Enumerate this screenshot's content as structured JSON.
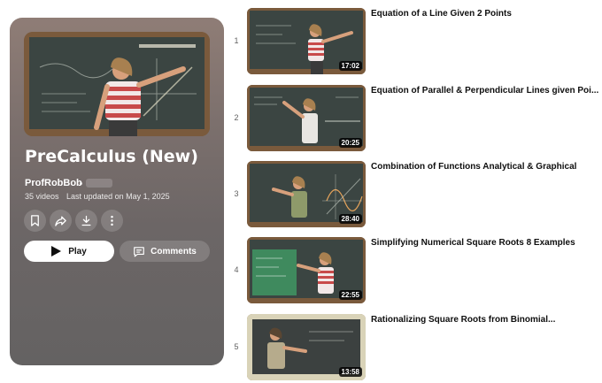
{
  "playlist": {
    "title": "PreCalculus (New)",
    "channel": "ProfRobBob",
    "video_count": "35 videos",
    "last_updated": "Last updated on May 1, 2025",
    "play_label": "Play",
    "comments_label": "Comments",
    "actions": [
      "save-icon",
      "share-icon",
      "download-icon",
      "more-icon"
    ]
  },
  "videos": [
    {
      "index": "1",
      "title": "Equation of a Line Given 2 Points",
      "duration": "17:02"
    },
    {
      "index": "2",
      "title": "Equation of Parallel & Perpendicular Lines given Poi...",
      "duration": "20:25"
    },
    {
      "index": "3",
      "title": "Combination of Functions Analytical & Graphical",
      "duration": "28:40"
    },
    {
      "index": "4",
      "title": "Simplifying Numerical Square Roots 8 Examples",
      "duration": "22:55"
    },
    {
      "index": "5",
      "title": "Rationalizing Square Roots from Binomial...",
      "duration": "13:58"
    }
  ],
  "colors": {
    "panel_gradient_top": "#8f7d76",
    "panel_gradient_bottom": "#646262",
    "chalkboard": "#3b4542",
    "green_board": "#3f8a5e",
    "frame_wood": "#7a5a3c"
  }
}
